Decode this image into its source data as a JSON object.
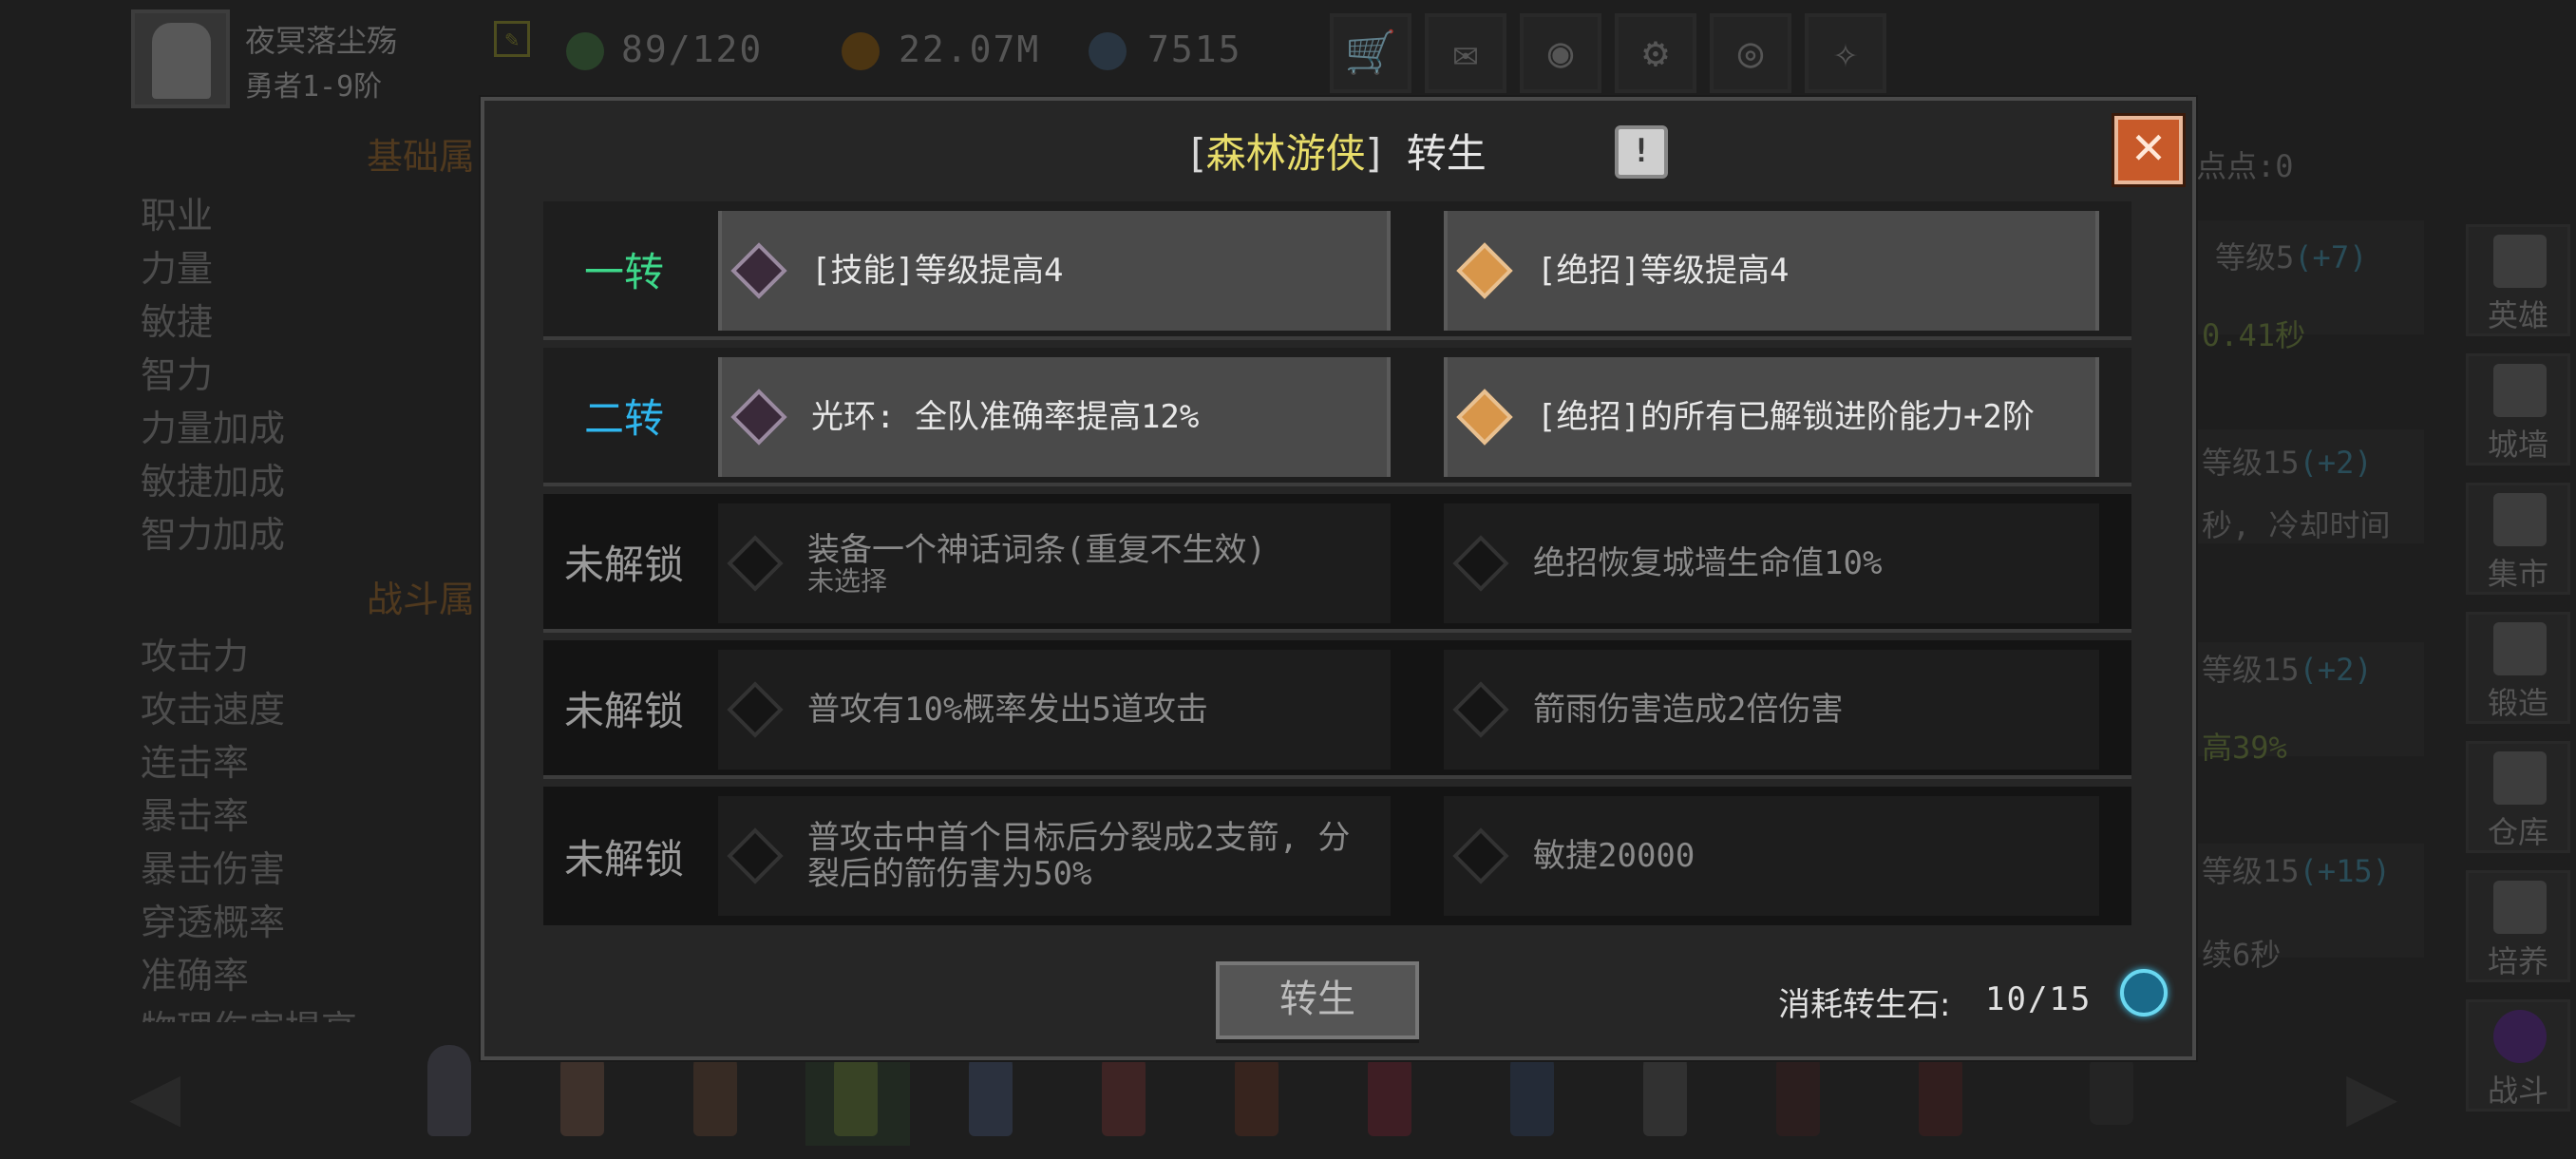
{
  "header": {
    "player_name": "夜冥落尘殇",
    "player_rank": "勇者1-9阶",
    "stamina": "89/120",
    "gold": "22.07M",
    "gems": "7515"
  },
  "left_panel": {
    "section_basic": "基础属",
    "basic_items": [
      "职业",
      "力量",
      "敏捷",
      "智力",
      "力量加成",
      "敏捷加成",
      "智力加成"
    ],
    "section_combat": "战斗属",
    "combat_items": [
      "攻击力",
      "攻击速度",
      "连击率",
      "暴击率",
      "暴击伤害",
      "穿透概率",
      "准确率",
      "物理伤害提高"
    ]
  },
  "right_panel": {
    "points_label": "点点:0",
    "rows": [
      {
        "line1": "等级5",
        "bonus": "(+7)",
        "line2": "0.41秒"
      },
      {
        "line1": "等级15",
        "bonus": "(+2)",
        "line2": "秒, 冷却时间"
      },
      {
        "line1": "等级15",
        "bonus": "(+2)",
        "line2": "高39%"
      },
      {
        "line1": "等级15",
        "bonus": "(+15)",
        "line2": "续6秒"
      }
    ]
  },
  "side_nav": [
    "英雄",
    "城墙",
    "集市",
    "锻造",
    "仓库",
    "培养",
    "战斗"
  ],
  "modal": {
    "title_bracket_open": "[",
    "title_class": "森林游侠",
    "title_bracket_close": "]",
    "title_suffix": "转生",
    "info_symbol": "!",
    "close_symbol": "✕",
    "rows": [
      {
        "label": "一转",
        "state": "unlocked",
        "options": [
          {
            "text": "[技能]等级提高4",
            "sub": "",
            "gem": "purple",
            "active": true
          },
          {
            "text": "[绝招]等级提高4",
            "sub": "",
            "gem": "orange",
            "active": true
          }
        ]
      },
      {
        "label": "二转",
        "state": "unlocked",
        "options": [
          {
            "text": "光环: 全队准确率提高12%",
            "sub": "",
            "gem": "purple",
            "active": true
          },
          {
            "text": "[绝招]的所有已解锁进阶能力+2阶",
            "sub": "",
            "gem": "orange",
            "active": true
          }
        ]
      },
      {
        "label": "未解锁",
        "state": "locked",
        "options": [
          {
            "text": "装备一个神话词条(重复不生效)",
            "sub": "未选择",
            "gem": "dark",
            "active": false
          },
          {
            "text": "绝招恢复城墙生命值10%",
            "sub": "",
            "gem": "dark",
            "active": false
          }
        ]
      },
      {
        "label": "未解锁",
        "state": "locked",
        "options": [
          {
            "text": "普攻有10%概率发出5道攻击",
            "sub": "",
            "gem": "dark",
            "active": false
          },
          {
            "text": "箭雨伤害造成2倍伤害",
            "sub": "",
            "gem": "dark",
            "active": false
          }
        ]
      },
      {
        "label": "未解锁",
        "state": "locked",
        "options": [
          {
            "text": "普攻击中首个目标后分裂成2支箭, 分裂后的箭伤害为50%",
            "sub": "",
            "gem": "dark",
            "active": false
          },
          {
            "text": "敏捷20000",
            "sub": "",
            "gem": "dark",
            "active": false
          }
        ]
      }
    ],
    "rebirth_button": "转生",
    "cost_label": "消耗转生石:",
    "cost_value": "10/15"
  },
  "colors": {
    "class_name": "#e8dd6a",
    "first_rebirth": "#3dd88a",
    "second_rebirth": "#2fb6ee",
    "close_button": "#c85a2a",
    "gem_orange": "#d8964a"
  }
}
